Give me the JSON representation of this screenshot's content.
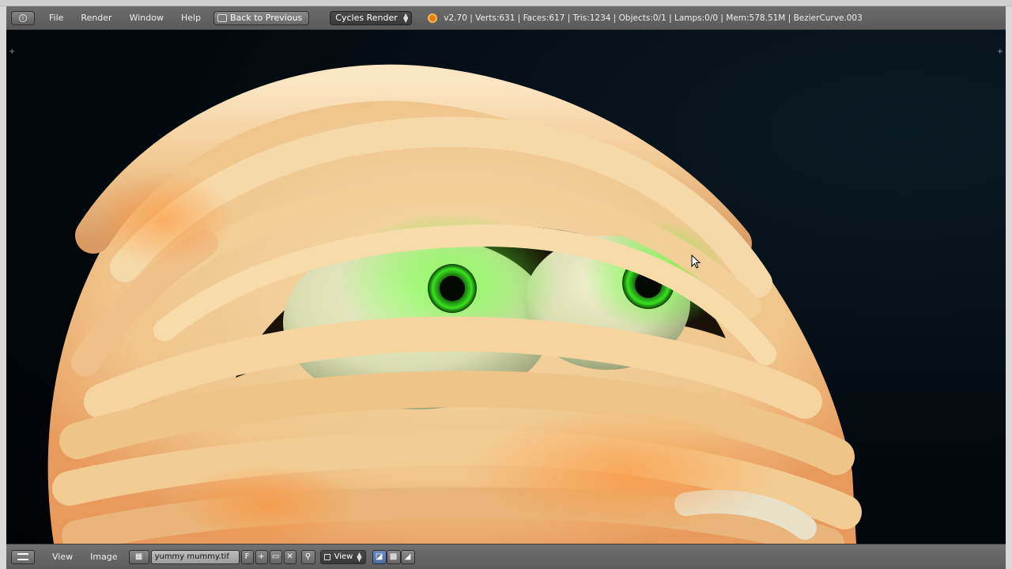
{
  "top_header": {
    "menus": [
      "File",
      "Render",
      "Window",
      "Help"
    ],
    "back_button": "Back to Previous",
    "render_engine": "Cycles Render",
    "stats": "v2.70 | Verts:631 | Faces:617 | Tris:1234 | Objects:0/1 | Lamps:0/0 | Mem:578.51M | BezierCurve.003"
  },
  "bottom_header": {
    "menus": [
      "View",
      "Image"
    ],
    "image_name": "yummy mummy.tif",
    "fake_user_label": "F",
    "view_select": "View"
  },
  "colors": {
    "accent_orange": "#e87d0d",
    "eye_green": "#33ff22",
    "bandage": "#f2cf9a",
    "background": "#02080d"
  }
}
